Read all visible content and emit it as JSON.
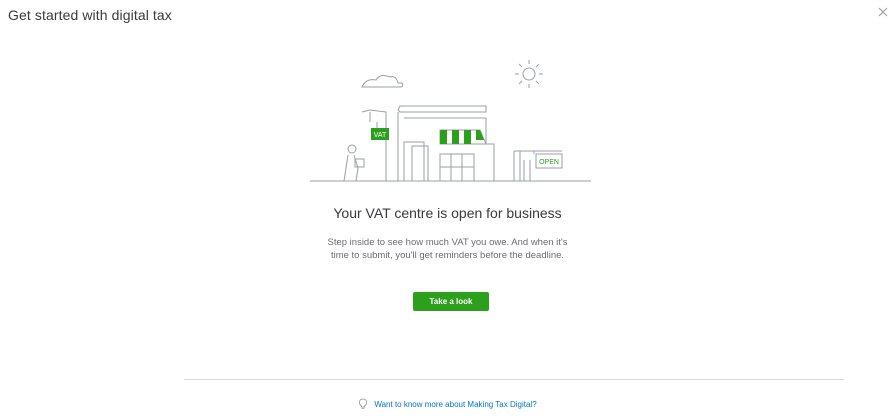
{
  "modal": {
    "title": "Get started with digital tax"
  },
  "illustration": {
    "vat_sign": "VAT",
    "open_sign": "OPEN"
  },
  "content": {
    "headline": "Your VAT centre is open for business",
    "body_line1": "Step inside to see how much VAT you owe. And when it's",
    "body_line2": "time to submit, you'll get reminders before the deadline.",
    "cta_label": "Take a look"
  },
  "footer": {
    "link_text": "Want to know more about Making Tax Digital?"
  },
  "icons": {
    "close": "close-icon",
    "bulb": "lightbulb-icon"
  },
  "colors": {
    "accent_green": "#2ca01c",
    "link_blue": "#0077c5",
    "text_dark": "#393a3d"
  }
}
